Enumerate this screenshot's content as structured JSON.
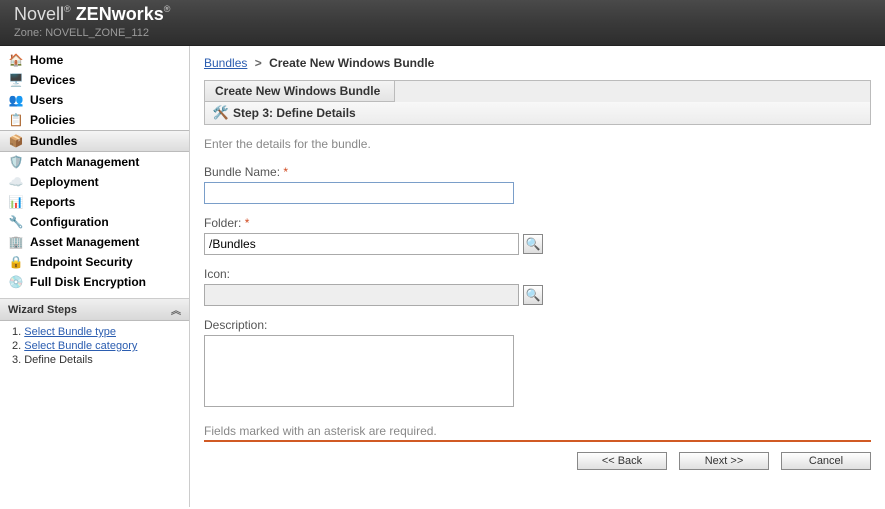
{
  "header": {
    "brand1": "Novell",
    "brand2": "ZENworks",
    "zone_label": "Zone:",
    "zone_name": "NOVELL_ZONE_112"
  },
  "nav": {
    "items": [
      {
        "label": "Home",
        "icon": "🏠"
      },
      {
        "label": "Devices",
        "icon": "🖥️"
      },
      {
        "label": "Users",
        "icon": "👥"
      },
      {
        "label": "Policies",
        "icon": "📋"
      },
      {
        "label": "Bundles",
        "icon": "📦",
        "selected": true
      },
      {
        "label": "Patch Management",
        "icon": "🛡️"
      },
      {
        "label": "Deployment",
        "icon": "☁️"
      },
      {
        "label": "Reports",
        "icon": "📊"
      },
      {
        "label": "Configuration",
        "icon": "🔧"
      },
      {
        "label": "Asset Management",
        "icon": "🏢"
      },
      {
        "label": "Endpoint Security",
        "icon": "🔒"
      },
      {
        "label": "Full Disk Encryption",
        "icon": "💿"
      }
    ]
  },
  "wizard": {
    "title": "Wizard Steps",
    "steps": [
      {
        "label": "Select Bundle type",
        "link": true
      },
      {
        "label": "Select Bundle category",
        "link": true
      },
      {
        "label": "Define Details",
        "link": false
      }
    ]
  },
  "breadcrumb": {
    "root": "Bundles",
    "sep": ">",
    "current": "Create New Windows Bundle"
  },
  "panel": {
    "title": "Create New Windows Bundle",
    "step_icon": "🛠️",
    "step_text": "Step 3: Define Details"
  },
  "form": {
    "instruction": "Enter the details for the bundle.",
    "name_label_text": "Bundle Name: ",
    "name_required": "*",
    "name_value": "",
    "folder_label_text": "Folder: ",
    "folder_required": "*",
    "folder_value": "/Bundles",
    "icon_label": "Icon:",
    "icon_value": "",
    "desc_label": "Description:",
    "desc_value": "",
    "footnote": "Fields marked with an asterisk are required.",
    "browse_glyph": "🔍"
  },
  "buttons": {
    "back": "<< Back",
    "next": "Next >>",
    "cancel": "Cancel"
  }
}
